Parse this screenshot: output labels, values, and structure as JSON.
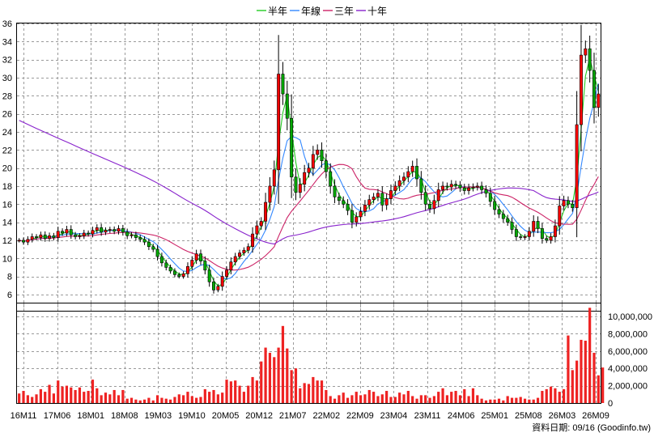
{
  "legend": [
    {
      "key": "ma_half",
      "label": "半年",
      "color": "#22cc22"
    },
    {
      "key": "ma_year",
      "label": "年線",
      "color": "#3388ff"
    },
    {
      "key": "ma_three",
      "label": "三年",
      "color": "#cc2266"
    },
    {
      "key": "ma_ten",
      "label": "十年",
      "color": "#8822cc"
    }
  ],
  "footer_note": "資料日期: 09/16  (Goodinfo.tw)",
  "colors": {
    "up": "#ff0000",
    "down": "#00aa00",
    "volume": "#ee2222",
    "grid": "#9a9a9a"
  },
  "chart_data": [
    {
      "type": "candlestick",
      "title": "",
      "y_ticks": [
        6,
        8,
        10,
        12,
        14,
        16,
        18,
        20,
        22,
        24,
        26,
        28,
        30,
        32,
        34,
        36
      ],
      "ylim": [
        4.2,
        36
      ],
      "x_tick_labels": [
        "16M11",
        "17M06",
        "18M01",
        "18M08",
        "19M03",
        "19M10",
        "20M05",
        "20M12",
        "21M07",
        "22M02",
        "22M09",
        "23M04",
        "23M11",
        "24M06",
        "25M01",
        "25M08",
        "26M03",
        "26M09"
      ],
      "grid": true,
      "legend_position": "top",
      "close": [
        12.0,
        11.8,
        12.1,
        12.4,
        12.3,
        12.6,
        12.2,
        12.5,
        12.3,
        13.0,
        12.8,
        13.2,
        12.6,
        12.4,
        12.5,
        12.8,
        12.7,
        13.1,
        13.4,
        12.9,
        13.1,
        13.2,
        13.0,
        13.3,
        12.9,
        12.5,
        12.6,
        12.3,
        12.1,
        11.8,
        11.3,
        11.0,
        10.2,
        9.5,
        9.0,
        8.6,
        8.2,
        8.0,
        8.3,
        9.1,
        9.8,
        10.5,
        9.7,
        8.7,
        7.4,
        6.5,
        6.9,
        8.0,
        8.7,
        9.6,
        10.2,
        10.6,
        10.9,
        11.3,
        12.7,
        13.6,
        14.1,
        16.2,
        18.0,
        19.8,
        30.4,
        28.2,
        25.5,
        19.0,
        17.3,
        18.2,
        19.5,
        20.0,
        21.5,
        22.0,
        20.8,
        19.6,
        18.0,
        16.8,
        16.4,
        16.0,
        15.3,
        14.0,
        14.6,
        15.2,
        15.9,
        16.5,
        16.8,
        17.2,
        15.9,
        16.6,
        17.5,
        18.0,
        18.6,
        19.0,
        19.6,
        20.2,
        18.8,
        17.3,
        16.0,
        15.5,
        16.4,
        17.6,
        18.0,
        17.9,
        18.2,
        18.1,
        17.8,
        17.5,
        17.8,
        17.9,
        18.0,
        17.6,
        17.2,
        16.3,
        15.4,
        14.9,
        14.4,
        14.0,
        13.2,
        12.4,
        12.3,
        12.4,
        13.0,
        14.1,
        13.3,
        12.2,
        12.0,
        12.4,
        13.6,
        15.8,
        16.4,
        16.0,
        15.6,
        24.8,
        32.5,
        33.2,
        30.8,
        26.7,
        28.2
      ],
      "volume": {
        "axis_ticks": [
          0,
          2000000,
          4000000,
          6000000,
          8000000,
          10000000
        ],
        "axis_tick_labels": [
          "0",
          "2,000,000",
          "4,000,000",
          "6,000,000",
          "8,000,000",
          "10,000,000"
        ],
        "ylim": [
          0,
          11500000
        ],
        "values": [
          1100000,
          1400000,
          900000,
          700000,
          1000000,
          1600000,
          1300000,
          2100000,
          1100000,
          2600000,
          1900000,
          2000000,
          1800000,
          1500000,
          1800000,
          1300000,
          1400000,
          2700000,
          1700000,
          900000,
          1200000,
          1000000,
          1500000,
          900000,
          1500000,
          500000,
          600000,
          400000,
          300000,
          400000,
          600000,
          300000,
          900000,
          600000,
          500000,
          400000,
          700000,
          1000000,
          900000,
          1300000,
          800000,
          600000,
          700000,
          1600000,
          1300000,
          1500000,
          1000000,
          1200000,
          2700000,
          2500000,
          2600000,
          2000000,
          1300000,
          2000000,
          3000000,
          2600000,
          4800000,
          6400000,
          5800000,
          5300000,
          6400000,
          8900000,
          6300000,
          3800000,
          4000000,
          1700000,
          2300000,
          2200000,
          3000000,
          2600000,
          2600000,
          1500000,
          800000,
          500000,
          900000,
          1200000,
          600000,
          900000,
          1300000,
          900000,
          1000000,
          1500000,
          1300000,
          800000,
          1000000,
          1400000,
          700000,
          700000,
          1200000,
          1000000,
          1400000,
          800000,
          500000,
          900000,
          900000,
          600000,
          800000,
          1300000,
          1700000,
          900000,
          1300000,
          1400000,
          900000,
          1600000,
          800000,
          1700000,
          900000,
          500000,
          300000,
          400000,
          400000,
          500000,
          300000,
          800000,
          600000,
          600000,
          700000,
          500000,
          400000,
          400000,
          600000,
          1400000,
          1600000,
          1900000,
          1700000,
          1300000,
          1600000,
          7800000,
          3800000,
          4900000,
          7300000,
          7200000,
          11000000,
          5800000,
          3200000,
          4100000
        ]
      }
    }
  ]
}
